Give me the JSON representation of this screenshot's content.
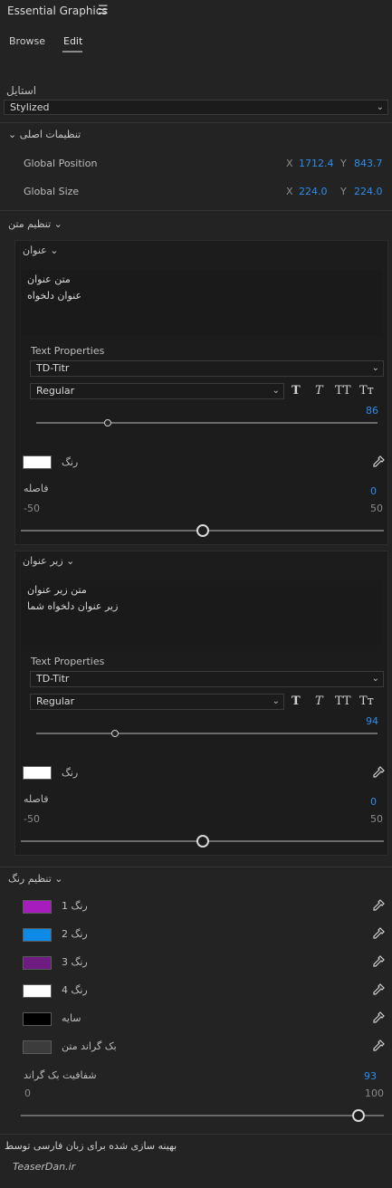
{
  "panel": {
    "title": "Essential Graphics",
    "menu_icon": "hamburger-icon"
  },
  "tabs": [
    {
      "label": "Browse"
    },
    {
      "label": "Edit"
    }
  ],
  "style": {
    "label": "استایل",
    "value": "Stylized"
  },
  "main_settings": {
    "header": "تنظیمات اصلی",
    "global_position": {
      "label": "Global Position",
      "x_label": "X",
      "x": "1712.4",
      "y_label": "Y",
      "y": "843.7"
    },
    "global_size": {
      "label": "Global Size",
      "x_label": "X",
      "x": "224.0",
      "y_label": "Y",
      "y": "224.0"
    }
  },
  "text_settings": {
    "header": "تنظیم متن"
  },
  "title_block": {
    "header": "عنوان",
    "text_line1": "متن عنوان",
    "text_line2": "عنوان دلخواه",
    "text_props_label": "Text Properties",
    "font": "TD-Titr",
    "weight": "Regular",
    "font_size": "86",
    "font_size_fraction": 0.21,
    "color_label": "رنگ",
    "color": "#ffffff",
    "spacing_label": "فاصله",
    "spacing_value": "0",
    "spacing_min": "-50",
    "spacing_max": "50",
    "spacing_fraction": 0.5
  },
  "subtitle_block": {
    "header": "زیر عنوان",
    "text_line1": "متن زیر عنوان",
    "text_line2": "زیر عنوان دلخواه شما",
    "text_props_label": "Text Properties",
    "font": "TD-Titr",
    "weight": "Regular",
    "font_size": "94",
    "font_size_fraction": 0.23,
    "color_label": "رنگ",
    "color": "#ffffff",
    "spacing_label": "فاصله",
    "spacing_value": "0",
    "spacing_min": "-50",
    "spacing_max": "50",
    "spacing_fraction": 0.5
  },
  "style_buttons": {
    "bold": "T",
    "italic": "T",
    "allcaps": "TT",
    "smallcaps": "Tт"
  },
  "color_settings": {
    "header": "تنظیم رنگ",
    "colors": [
      {
        "label": "رنگ 1",
        "color": "#a61cbd"
      },
      {
        "label": "رنگ 2",
        "color": "#0c8ae6"
      },
      {
        "label": "رنگ 3",
        "color": "#6e1b82"
      },
      {
        "label": "رنگ 4",
        "color": "#ffffff"
      },
      {
        "label": "سایه",
        "color": "#000000"
      },
      {
        "label": "بک گراند متن",
        "color": "#3c3c3c"
      }
    ],
    "opacity_label": "شفافیت بک گراند",
    "opacity_value": "93",
    "opacity_min": "0",
    "opacity_max": "100",
    "opacity_fraction": 0.93
  },
  "footer": {
    "text": "بهینه سازی شده برای زبان فارسی توسط",
    "brand": "TeaserDan.ir"
  }
}
